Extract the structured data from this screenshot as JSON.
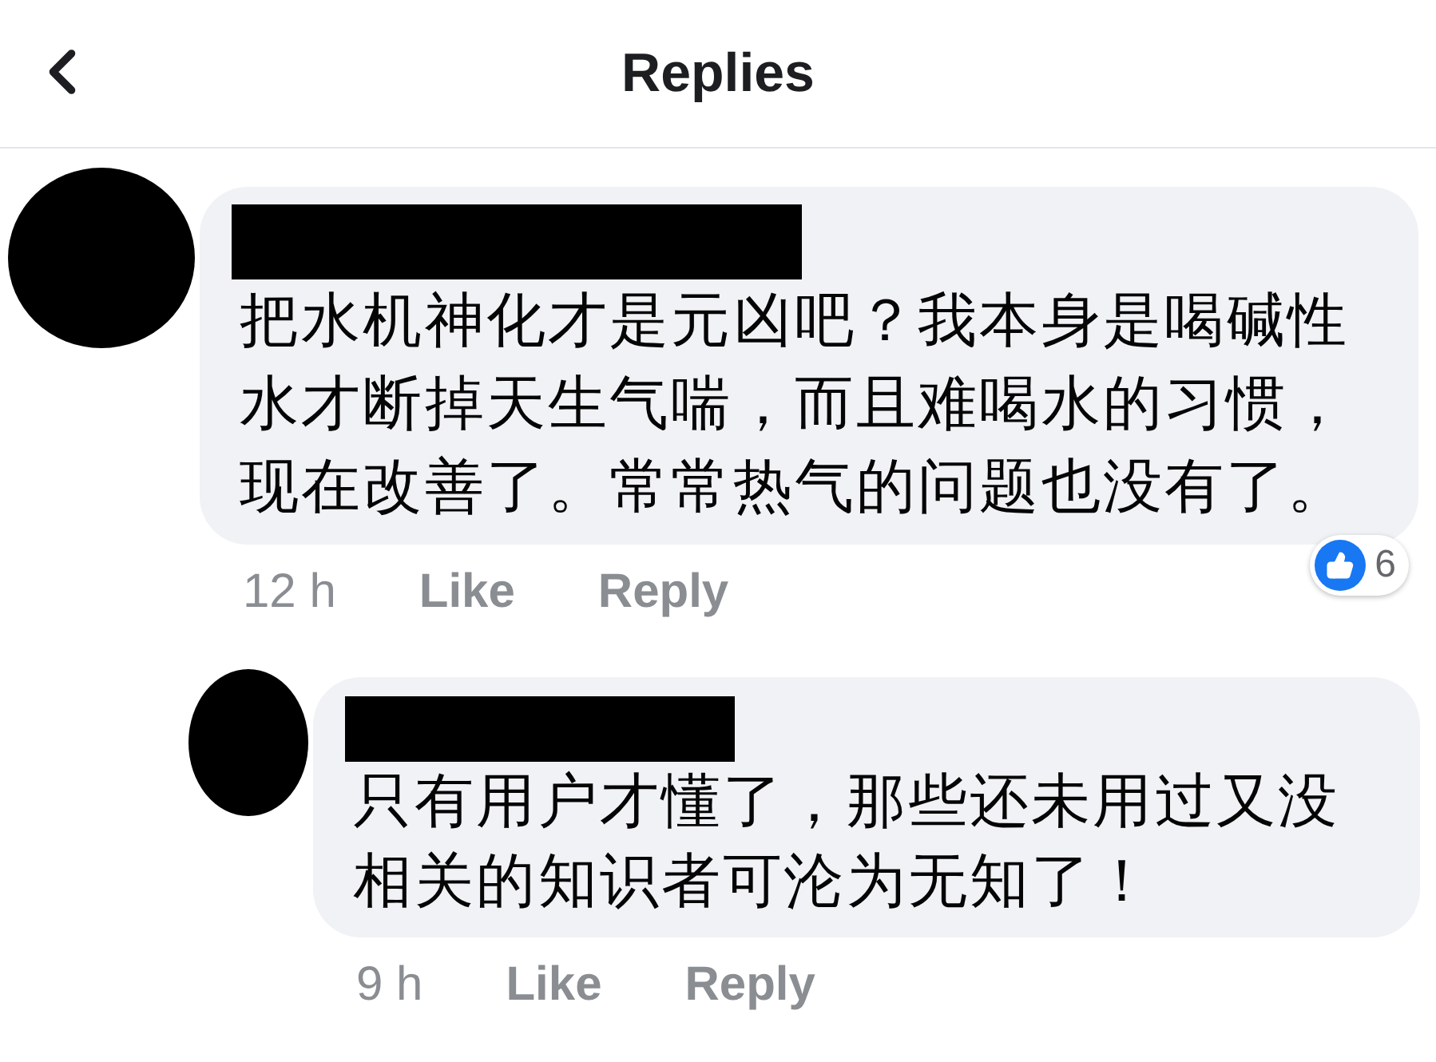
{
  "header": {
    "title": "Replies"
  },
  "comments": [
    {
      "text": "把水机神化才是元凶吧？我本身是喝碱性水才断掉天生气喘，而且难喝水的习惯，现在改善了。常常热气的问题也没有了。",
      "time": "12 h",
      "like": "Like",
      "reply": "Reply",
      "reaction_count": "6",
      "children": [
        {
          "text": "只有用户才懂了，那些还未用过又没相关的知识者可沦为无知了！",
          "time": "9 h",
          "like": "Like",
          "reply": "Reply"
        }
      ]
    }
  ]
}
